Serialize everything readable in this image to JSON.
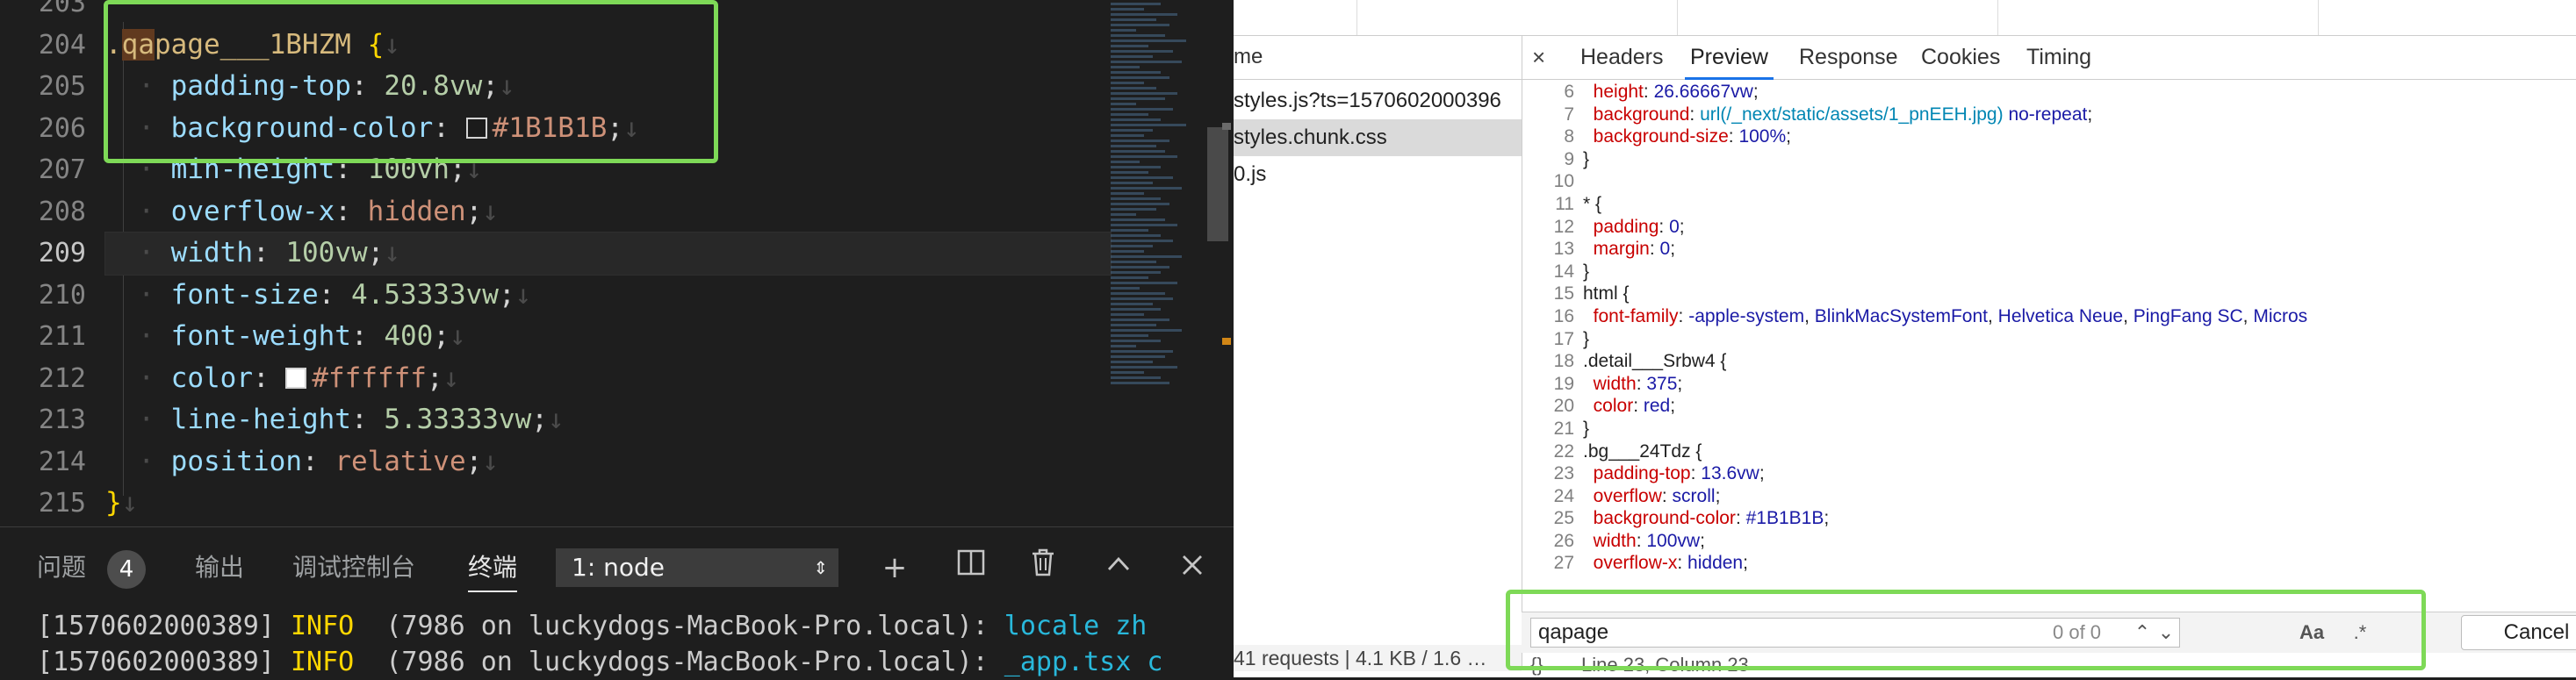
{
  "editor": {
    "line_numbers": [
      "203",
      "204",
      "205",
      "206",
      "207",
      "208",
      "209",
      "210",
      "211",
      "212",
      "213",
      "214",
      "215"
    ],
    "active_line": "209",
    "selector": "qapage___1BHZM",
    "selector_prefix": ".",
    "open_brace": " {",
    "close_brace": "}",
    "props": [
      {
        "name": "padding-top",
        "value": "20.8vw"
      },
      {
        "name": "background-color",
        "value": "#1B1B1B",
        "swatch": "#1B1B1B"
      },
      {
        "name": "min-height",
        "value": "100vh"
      },
      {
        "name": "overflow-x",
        "value": "hidden"
      },
      {
        "name": "width",
        "value": "100vw"
      },
      {
        "name": "font-size",
        "value": "4.53333vw"
      },
      {
        "name": "font-weight",
        "value": "400"
      },
      {
        "name": "color",
        "value": "#ffffff",
        "swatch": "#ffffff"
      },
      {
        "name": "line-height",
        "value": "5.33333vw"
      },
      {
        "name": "position",
        "value": "relative"
      }
    ]
  },
  "panel": {
    "tabs": [
      "问题",
      "输出",
      "调试控制台",
      "终端"
    ],
    "problems_count": "4",
    "terminal_select": "1: node",
    "icons": [
      "plus-icon",
      "split-icon",
      "trash-icon",
      "chevron-up-icon",
      "close-icon"
    ],
    "terminal_lines": [
      {
        "ts": "[1570602000389]",
        "level": "INFO",
        "msg": "(7986 on luckydogs-MacBook-Pro.local): ",
        "hl": "locale zh"
      },
      {
        "ts": "[1570602000389]",
        "level": "INFO",
        "msg": "(7986 on luckydogs-MacBook-Pro.local): ",
        "hl": "_app.tsx c"
      }
    ]
  },
  "devtools": {
    "name_header": "me",
    "requests": [
      "styles.js?ts=1570602000396",
      "styles.chunk.css",
      "0.js"
    ],
    "selected_request": "styles.chunk.css",
    "tabs": [
      "Headers",
      "Preview",
      "Response",
      "Cookies",
      "Timing"
    ],
    "active_tab": "Preview",
    "close_glyph": "×",
    "find_query": "qapage",
    "find_count": "0 of 0",
    "find_case_btn": "Aa",
    "find_regex_btn": ".*",
    "cancel_label": "Cancel",
    "status_text": "Line 23, Column 23",
    "status_icon": "{}",
    "summary": "41 requests | 4.1 KB / 1.6 …"
  },
  "colors": {
    "highlight": "#7ed957",
    "accent": "#1a73e8"
  }
}
